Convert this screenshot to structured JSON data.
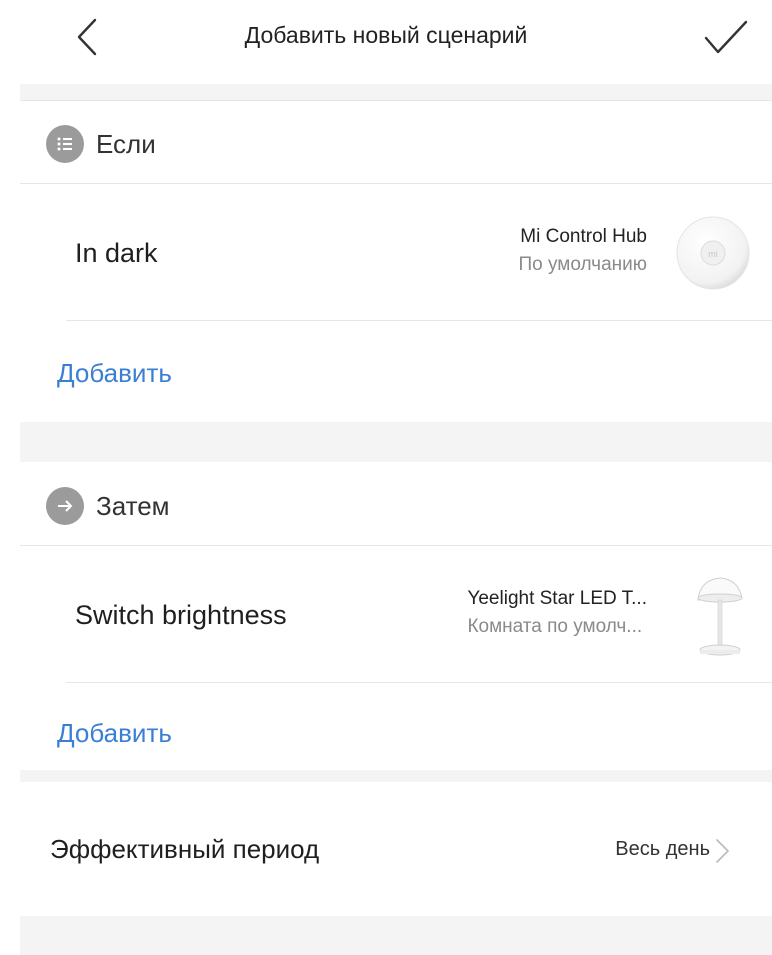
{
  "header": {
    "title": "Добавить новый сценарий",
    "back_icon": "chevron-left-icon",
    "confirm_icon": "checkmark-icon"
  },
  "if_section": {
    "label": "Если",
    "icon": "list-icon",
    "condition": {
      "name": "In dark",
      "device_name": "Mi Control Hub",
      "device_room": "По умолчанию",
      "device_icon": "mi-hub-icon"
    },
    "add_label": "Добавить"
  },
  "then_section": {
    "label": "Затем",
    "icon": "arrow-right-icon",
    "action": {
      "name": "Switch brightness",
      "device_name": "Yeelight Star LED T...",
      "device_room": "Комната по умолч...",
      "device_icon": "desk-lamp-icon"
    },
    "add_label": "Добавить"
  },
  "period": {
    "label": "Эффективный период",
    "value": "Весь день"
  },
  "colors": {
    "link": "#3b7fd4",
    "badge": "#9b9b9b",
    "separator": "#f4f4f4"
  }
}
